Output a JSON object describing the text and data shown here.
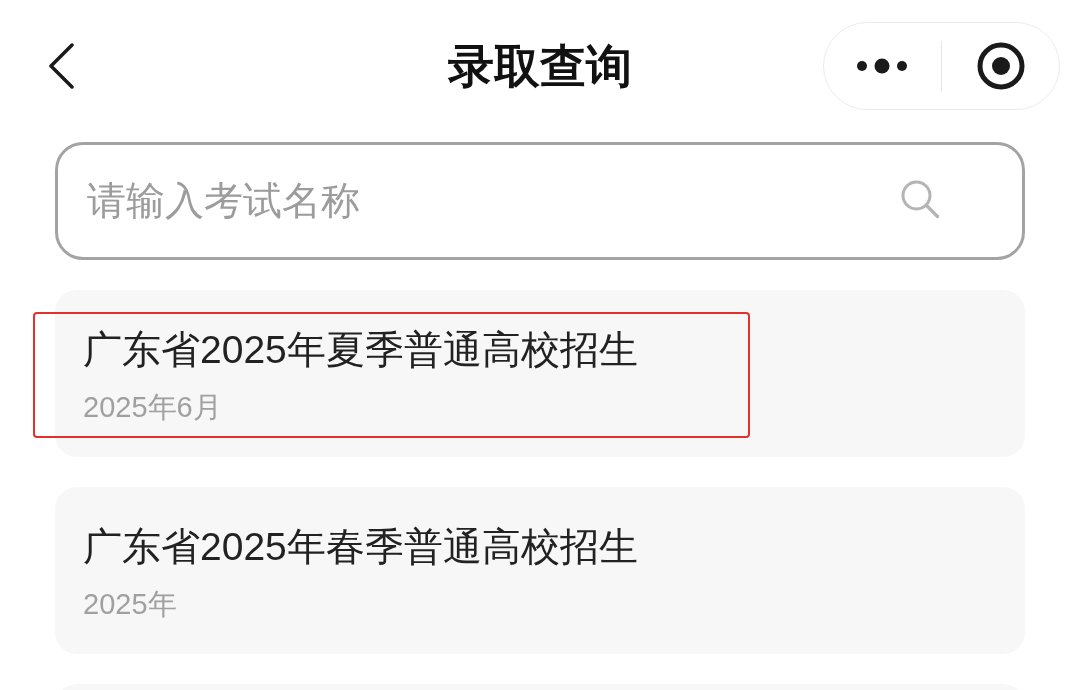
{
  "nav_bar": {
    "title": "录取查询"
  },
  "search": {
    "placeholder": "请输入考试名称"
  },
  "exam_list": [
    {
      "title": "广东省2025年夏季普通高校招生",
      "date": "2025年6月",
      "highlighted": true
    },
    {
      "title": "广东省2025年春季普通高校招生",
      "date": "2025年",
      "highlighted": false
    }
  ]
}
